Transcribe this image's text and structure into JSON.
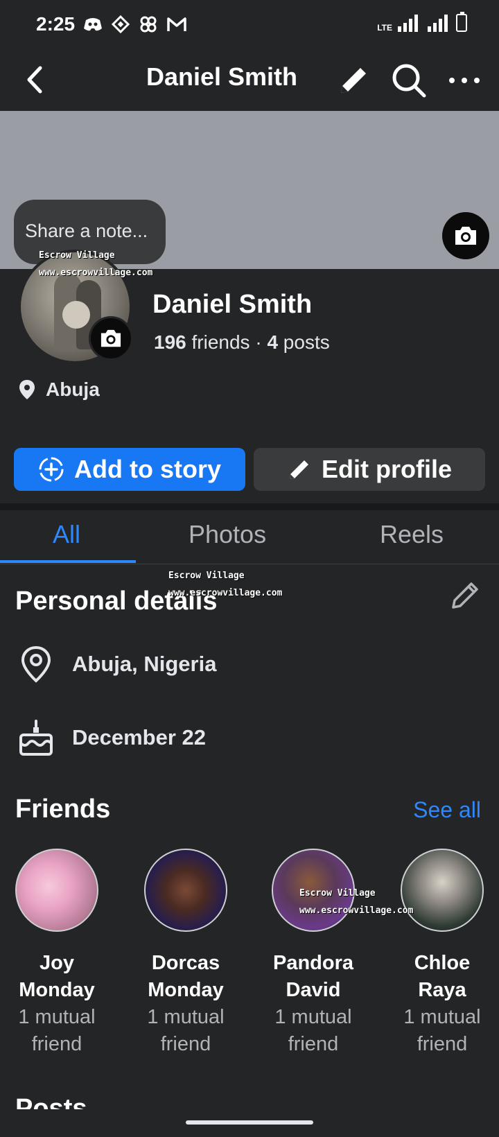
{
  "status_bar": {
    "time": "2:25",
    "network": "LTE"
  },
  "header": {
    "title": "Daniel Smith"
  },
  "note": {
    "placeholder": "Share a note..."
  },
  "watermark": {
    "line1": "Escrow Village",
    "line2": "www.escrowvillage.com"
  },
  "profile": {
    "name": "Daniel Smith",
    "friends_count": "196",
    "friends_label": "friends",
    "separator": "·",
    "posts_count": "4",
    "posts_label": "posts",
    "location": "Abuja"
  },
  "actions": {
    "add_story": "Add to story",
    "edit_profile": "Edit profile"
  },
  "tabs": [
    {
      "label": "All",
      "active": true
    },
    {
      "label": "Photos",
      "active": false
    },
    {
      "label": "Reels",
      "active": false
    }
  ],
  "personal_details": {
    "title": "Personal details",
    "location": "Abuja, Nigeria",
    "birthday": "December 22"
  },
  "friends": {
    "title": "Friends",
    "see_all": "See all",
    "list": [
      {
        "first": "Joy",
        "last": "Monday",
        "mutual_line1": "1 mutual",
        "mutual_line2": "friend"
      },
      {
        "first": "Dorcas",
        "last": "Monday",
        "mutual_line1": "1 mutual",
        "mutual_line2": "friend"
      },
      {
        "first": "Pandora",
        "last": "David",
        "mutual_line1": "1 mutual",
        "mutual_line2": "friend"
      },
      {
        "first": "Chloe",
        "last": "Raya",
        "mutual_line1": "1 mutual",
        "mutual_line2": "friend"
      }
    ]
  },
  "posts": {
    "title": "Posts"
  },
  "colors": {
    "background": "#242526",
    "accent": "#1877f2",
    "link": "#2d88ff",
    "secondary_button": "#3a3b3c",
    "cover": "#9a9da3"
  }
}
